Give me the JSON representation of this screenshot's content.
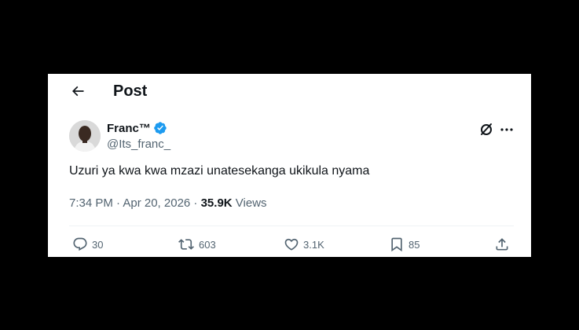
{
  "header": {
    "title": "Post"
  },
  "post": {
    "author": {
      "display_name": "Franc™",
      "handle": "@Its_franc_",
      "verified": true
    },
    "text": "Uzuri ya kwa kwa mzazi unatesekanga ukikula nyama",
    "timestamp": "7:34 PM · Apr 20, 2026 · ",
    "views_count": "35.9K",
    "views_label": " Views"
  },
  "actions": {
    "replies": "30",
    "reposts": "603",
    "likes": "3.1K",
    "bookmarks": "85"
  },
  "colors": {
    "background": "#000000",
    "card": "#ffffff",
    "text_primary": "#0f1419",
    "text_secondary": "#536471",
    "verified_blue": "#1d9bf0"
  },
  "icons": [
    "back-arrow-icon",
    "verified-badge-icon",
    "grok-icon",
    "more-icon",
    "reply-icon",
    "repost-icon",
    "like-icon",
    "bookmark-icon",
    "share-icon"
  ]
}
